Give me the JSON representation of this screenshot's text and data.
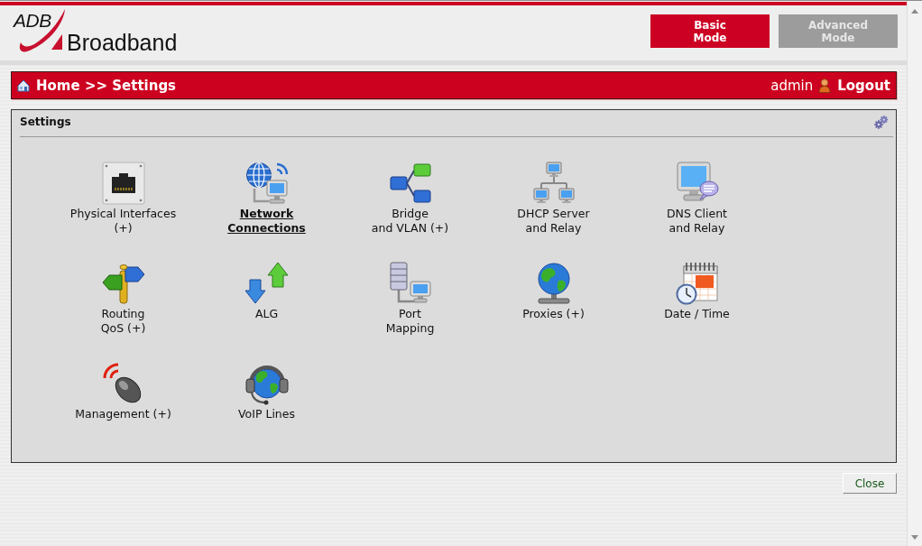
{
  "header": {
    "logo": {
      "mark": "ADB",
      "name": "Broadband"
    },
    "modes": [
      {
        "label": "Basic Mode",
        "selected": true
      },
      {
        "label": "Advanced Mode",
        "selected": false
      }
    ]
  },
  "breadcrumb": {
    "path": "Home >> Settings",
    "user": "admin",
    "logout": "Logout"
  },
  "panel": {
    "title": "Settings",
    "items": [
      {
        "label": "Physical Interfaces\n(+)",
        "selected": false
      },
      {
        "label": "Network\nConnections",
        "selected": true
      },
      {
        "label": "Bridge\nand VLAN (+)",
        "selected": false
      },
      {
        "label": "DHCP Server\nand Relay",
        "selected": false
      },
      {
        "label": "DNS Client\nand Relay",
        "selected": false
      },
      {
        "label": "Routing\nQoS (+)",
        "selected": false
      },
      {
        "label": "ALG",
        "selected": false
      },
      {
        "label": "Port\nMapping",
        "selected": false
      },
      {
        "label": "Proxies (+)",
        "selected": false
      },
      {
        "label": "Date / Time",
        "selected": false
      },
      {
        "label": "Management (+)",
        "selected": false
      },
      {
        "label": "VoIP Lines",
        "selected": false
      }
    ]
  },
  "footer": {
    "close": "Close"
  }
}
